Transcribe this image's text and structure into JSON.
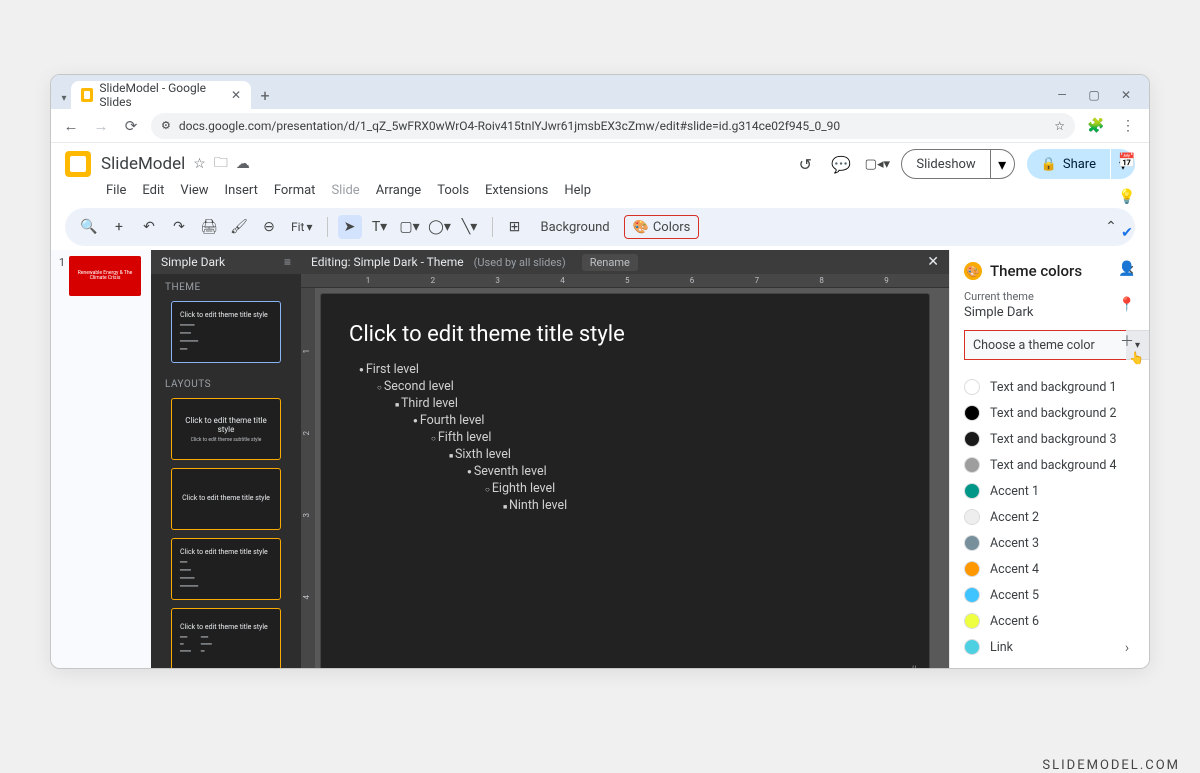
{
  "browser": {
    "tab_title": "SlideModel - Google Slides",
    "url": "docs.google.com/presentation/d/1_qZ_5wFRX0wWrO4-Roiv415tnIYJwr61jmsbEX3cZmw/edit#slide=id.g314ce02f945_0_90"
  },
  "header": {
    "doc_title": "SlideModel",
    "slideshow_label": "Slideshow",
    "share_label": "Share"
  },
  "menu": {
    "items": [
      "File",
      "Edit",
      "View",
      "Insert",
      "Format",
      "Slide",
      "Arrange",
      "Tools",
      "Extensions",
      "Help"
    ],
    "disabled_index": 5
  },
  "toolbar": {
    "zoom_label": "Fit",
    "background_label": "Background",
    "colors_label": "Colors"
  },
  "filmstrip": {
    "slide_number": "1",
    "thumb_text": "Renewable Energy & The Climate Crisis"
  },
  "theme_panel": {
    "header": "Simple Dark",
    "theme_label": "THEME",
    "layouts_label": "LAYOUTS",
    "layout_title_text": "Click to edit theme title style",
    "layout_subtitle_text": "Click to edit theme subtitle style"
  },
  "editor": {
    "editing_label": "Editing: Simple Dark - Theme",
    "used_by": "(Used by all slides)",
    "rename_label": "Rename",
    "canvas_title": "Click to edit theme title style",
    "levels": [
      "First level",
      "Second level",
      "Third level",
      "Fourth level",
      "Fifth level",
      "Sixth level",
      "Seventh level",
      "Eighth level",
      "Ninth level"
    ],
    "hash": "#",
    "ruler_ticks": [
      "1",
      "",
      "",
      "2",
      "",
      "",
      "3",
      "",
      "",
      "4",
      "",
      "",
      "5",
      "",
      "",
      "6",
      "",
      "",
      "7",
      "",
      "",
      "8",
      "",
      "",
      "9"
    ]
  },
  "right_panel": {
    "title": "Theme colors",
    "current_label": "Current theme",
    "theme_name": "Simple Dark",
    "dropdown_label": "Choose a theme color",
    "colors": [
      {
        "name": "Text and background 1",
        "hex": "#ffffff"
      },
      {
        "name": "Text and background 2",
        "hex": "#000000"
      },
      {
        "name": "Text and background 3",
        "hex": "#1a1a1a"
      },
      {
        "name": "Text and background 4",
        "hex": "#9e9e9e"
      },
      {
        "name": "Accent 1",
        "hex": "#009688"
      },
      {
        "name": "Accent 2",
        "hex": "#eeeeee"
      },
      {
        "name": "Accent 3",
        "hex": "#78909c"
      },
      {
        "name": "Accent 4",
        "hex": "#ff9800"
      },
      {
        "name": "Accent 5",
        "hex": "#40c4ff"
      },
      {
        "name": "Accent 6",
        "hex": "#eeff41"
      },
      {
        "name": "Link",
        "hex": "#4dd0e1"
      }
    ]
  },
  "watermark": "SLIDEMODEL.COM"
}
